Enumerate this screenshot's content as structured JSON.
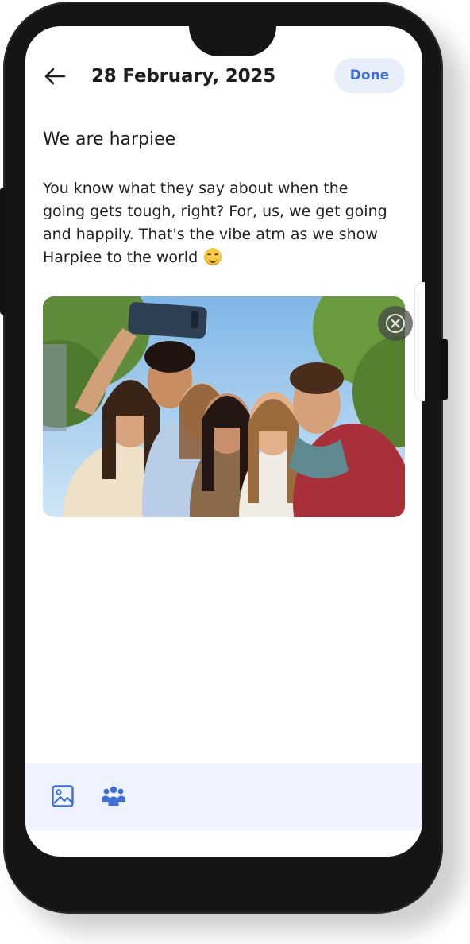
{
  "header": {
    "date": "28 February, 2025",
    "done_label": "Done"
  },
  "entry": {
    "title": "We are harpiee",
    "body": "You know what they say about when the going gets tough, right? For, us, we get going and happily. That's the vibe atm as we show Harpiee to the world"
  },
  "toolbar": {
    "icons": [
      "image-icon",
      "people-icon"
    ]
  },
  "colors": {
    "accent": "#3f6fd6",
    "done_bg": "#e9eefb",
    "toolbar_bg": "#eef3fd"
  }
}
